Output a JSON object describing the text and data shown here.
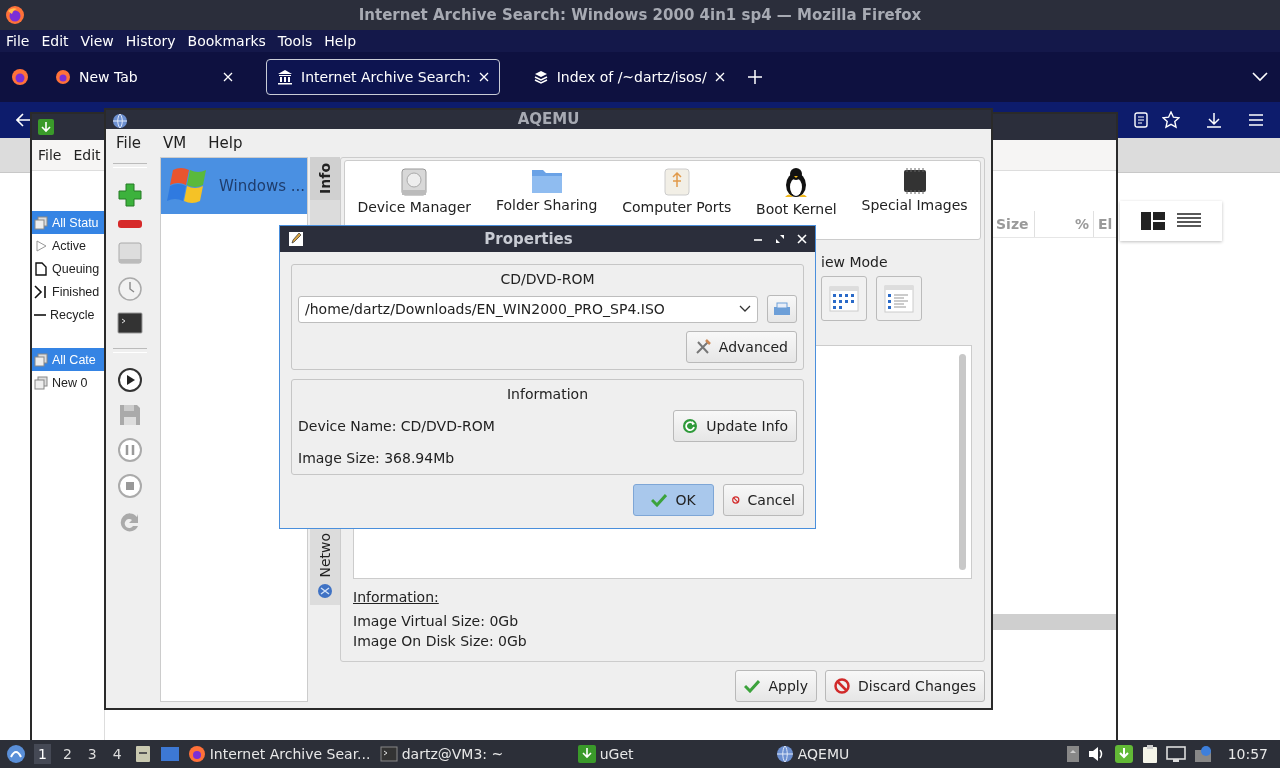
{
  "firefox": {
    "title": "Internet Archive Search: Windows 2000 4in1 sp4 — Mozilla Firefox",
    "menu": [
      "File",
      "Edit",
      "View",
      "History",
      "Bookmarks",
      "Tools",
      "Help"
    ],
    "tabs": [
      {
        "label": "New Tab",
        "selected": false
      },
      {
        "label": "Internet Archive Search:",
        "selected": true
      },
      {
        "label": "Index of /~dartz/isos/",
        "selected": false
      }
    ]
  },
  "uget": {
    "menu": [
      "File",
      "Edit"
    ],
    "status_items": [
      {
        "label": "All Statu",
        "selected": true
      },
      {
        "label": "Active",
        "selected": false
      },
      {
        "label": "Queuing",
        "selected": false
      },
      {
        "label": "Finished",
        "selected": false
      },
      {
        "label": "Recycle",
        "selected": false
      }
    ],
    "category_items": [
      {
        "label": "All Cate",
        "selected": true
      },
      {
        "label": "New 0",
        "selected": false
      }
    ],
    "columns": [
      "Size",
      "%",
      "El"
    ]
  },
  "aqemu": {
    "title": "AQEMU",
    "menu": [
      "File",
      "VM",
      "Help"
    ],
    "vm_list": [
      {
        "name": "Windows ...",
        "selected": true
      }
    ],
    "side_tabs": [
      {
        "label": "Info",
        "selected": true
      },
      {
        "label": "Netwo",
        "selected": false
      }
    ],
    "features": [
      "Device Manager",
      "Folder Sharing",
      "Computer Ports",
      "Boot Kernel",
      "Special Images"
    ],
    "view_mode_label": "iew Mode",
    "info_heading": "Information:",
    "info_lines": [
      "Image Virtual Size: 0Gb",
      "Image On Disk Size: 0Gb"
    ],
    "buttons": [
      "Apply",
      "Discard Changes"
    ]
  },
  "dialog": {
    "title": "Properties",
    "cdrom_heading": "CD/DVD-ROM",
    "path": "/home/dartz/Downloads/EN_WIN2000_PRO_SP4.ISO",
    "advanced_button": "Advanced",
    "info_heading": "Information",
    "device_name": "Device Name: CD/DVD-ROM",
    "update_button": "Update Info",
    "image_size": "Image Size: 368.94Mb",
    "buttons": [
      {
        "label": "OK",
        "selected": true
      },
      {
        "label": "Cancel",
        "selected": false
      }
    ]
  },
  "taskbar": {
    "workspaces": [
      {
        "label": "1",
        "selected": true
      },
      {
        "label": "2",
        "selected": false
      },
      {
        "label": "3",
        "selected": false
      },
      {
        "label": "4",
        "selected": false
      }
    ],
    "tasks": [
      "Internet Archive Sear...",
      "dartz@VM3: ~",
      "uGet",
      "AQEMU"
    ],
    "clock": "10:57"
  }
}
